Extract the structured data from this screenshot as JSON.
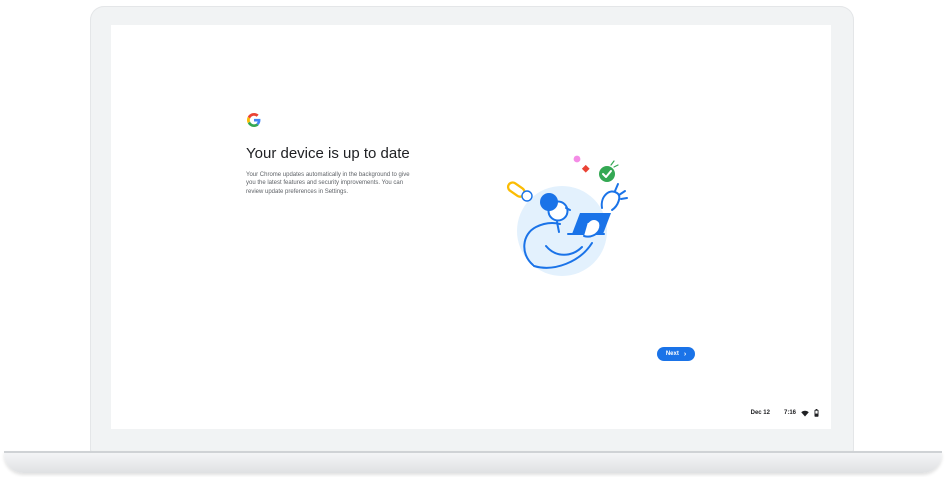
{
  "screen": {
    "title": "Your device is up to date",
    "description": "Your Chrome updates automatically in the background to give you the latest features and security improvements. You can review update preferences in Settings.",
    "logo_icon": "google-g-icon",
    "illustration": "person-with-laptop-illustration"
  },
  "actions": {
    "next_label": "Next",
    "next_icon": "chevron-right-icon"
  },
  "status_area": {
    "date": "Dec 12",
    "time": "7:16",
    "wifi_icon": "wifi-icon",
    "battery_icon": "battery-icon"
  },
  "colors": {
    "accent": "#1a73e8",
    "title": "#202124",
    "body": "#5f6368",
    "google_blue": "#4285f4",
    "google_red": "#ea4335",
    "google_yellow": "#fbbc04",
    "google_green": "#34a853"
  }
}
